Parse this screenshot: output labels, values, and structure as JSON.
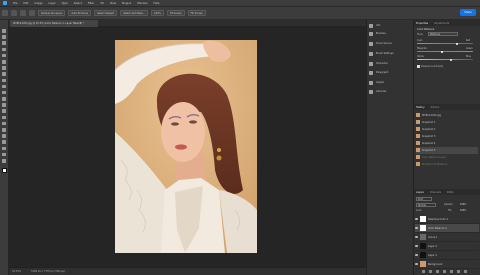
{
  "app": {
    "name": "Photoshop",
    "accent": "#31a8ff"
  },
  "menu": [
    "File",
    "Edit",
    "Image",
    "Layer",
    "Type",
    "Select",
    "Filter",
    "3D",
    "View",
    "Plugins",
    "Window",
    "Help"
  ],
  "options": {
    "sample_label": "Sample All Layers",
    "auto_enhance": "Auto-Enhance",
    "refine": "Select Subject",
    "mask": "Select and Mask...",
    "zoom_a": "100%",
    "zoom_b": "Fit Screen",
    "zoom_c": "Fill Screen"
  },
  "share_label": "Share",
  "document_tab": "PIXELS-DOC.jpg @ 33.3% (Color Balance 1, Layer Mask/8) *",
  "status": {
    "zoom": "33.33%",
    "info": "5184 px x 7776 px (300 ppi)"
  },
  "dock_panels": [
    "Info",
    "Brushes",
    "Clone Source",
    "Brush Settings",
    "Character",
    "Paragraph",
    "Glyphs",
    "Libraries"
  ],
  "properties": {
    "tabs": [
      "Properties",
      "Adjustments"
    ],
    "title": "Color Balance",
    "tone_label": "Tone:",
    "tone_value": "Midtones",
    "sliders": [
      {
        "left": "Cyan",
        "right": "Red",
        "value": 0,
        "pos": 0.72,
        "color_left": "#00d4d4",
        "color_right": "#e03030"
      },
      {
        "left": "Magenta",
        "right": "Green",
        "value": 0,
        "pos": 0.45,
        "color_left": "#d040d0",
        "color_right": "#40c040"
      },
      {
        "left": "Yellow",
        "right": "Blue",
        "value": 0,
        "pos": 0.6,
        "color_left": "#e0e020",
        "color_right": "#3050e0"
      }
    ],
    "preserve": "Preserve Luminosity"
  },
  "history": {
    "tabs": [
      "History",
      "Actions"
    ],
    "items": [
      {
        "label": "PIXELS-DOC.jpg",
        "state": "normal"
      },
      {
        "label": "Snapshot 1",
        "state": "normal"
      },
      {
        "label": "Snapshot 2",
        "state": "normal"
      },
      {
        "label": "Snapshot 3",
        "state": "normal"
      },
      {
        "label": "Snapshot 4",
        "state": "normal"
      },
      {
        "label": "Snapshot 5",
        "state": "selected"
      },
      {
        "label": "Color Balance Layer",
        "state": "dim"
      },
      {
        "label": "Modify Color Balance",
        "state": "dim"
      }
    ]
  },
  "layers": {
    "tabs": [
      "Layers",
      "Channels",
      "Paths"
    ],
    "kind_label": "Kind",
    "blend": "Normal",
    "opacity_label": "Opacity:",
    "opacity": "100%",
    "fill_label": "Fill:",
    "fill": "100%",
    "lock_label": "Lock:",
    "items": [
      {
        "name": "Selective Color 1",
        "thumb": "#ffffff",
        "selected": false
      },
      {
        "name": "Color Balance 1",
        "thumb": "#ffffff",
        "selected": true
      },
      {
        "name": "Group 1",
        "thumb": "#6a6a6a",
        "selected": false
      },
      {
        "name": "Layer 2",
        "thumb": "#111111",
        "selected": false
      },
      {
        "name": "Layer 1",
        "thumb": "#111111",
        "selected": false
      },
      {
        "name": "Background",
        "thumb": "#c89a6d",
        "selected": false
      }
    ]
  }
}
